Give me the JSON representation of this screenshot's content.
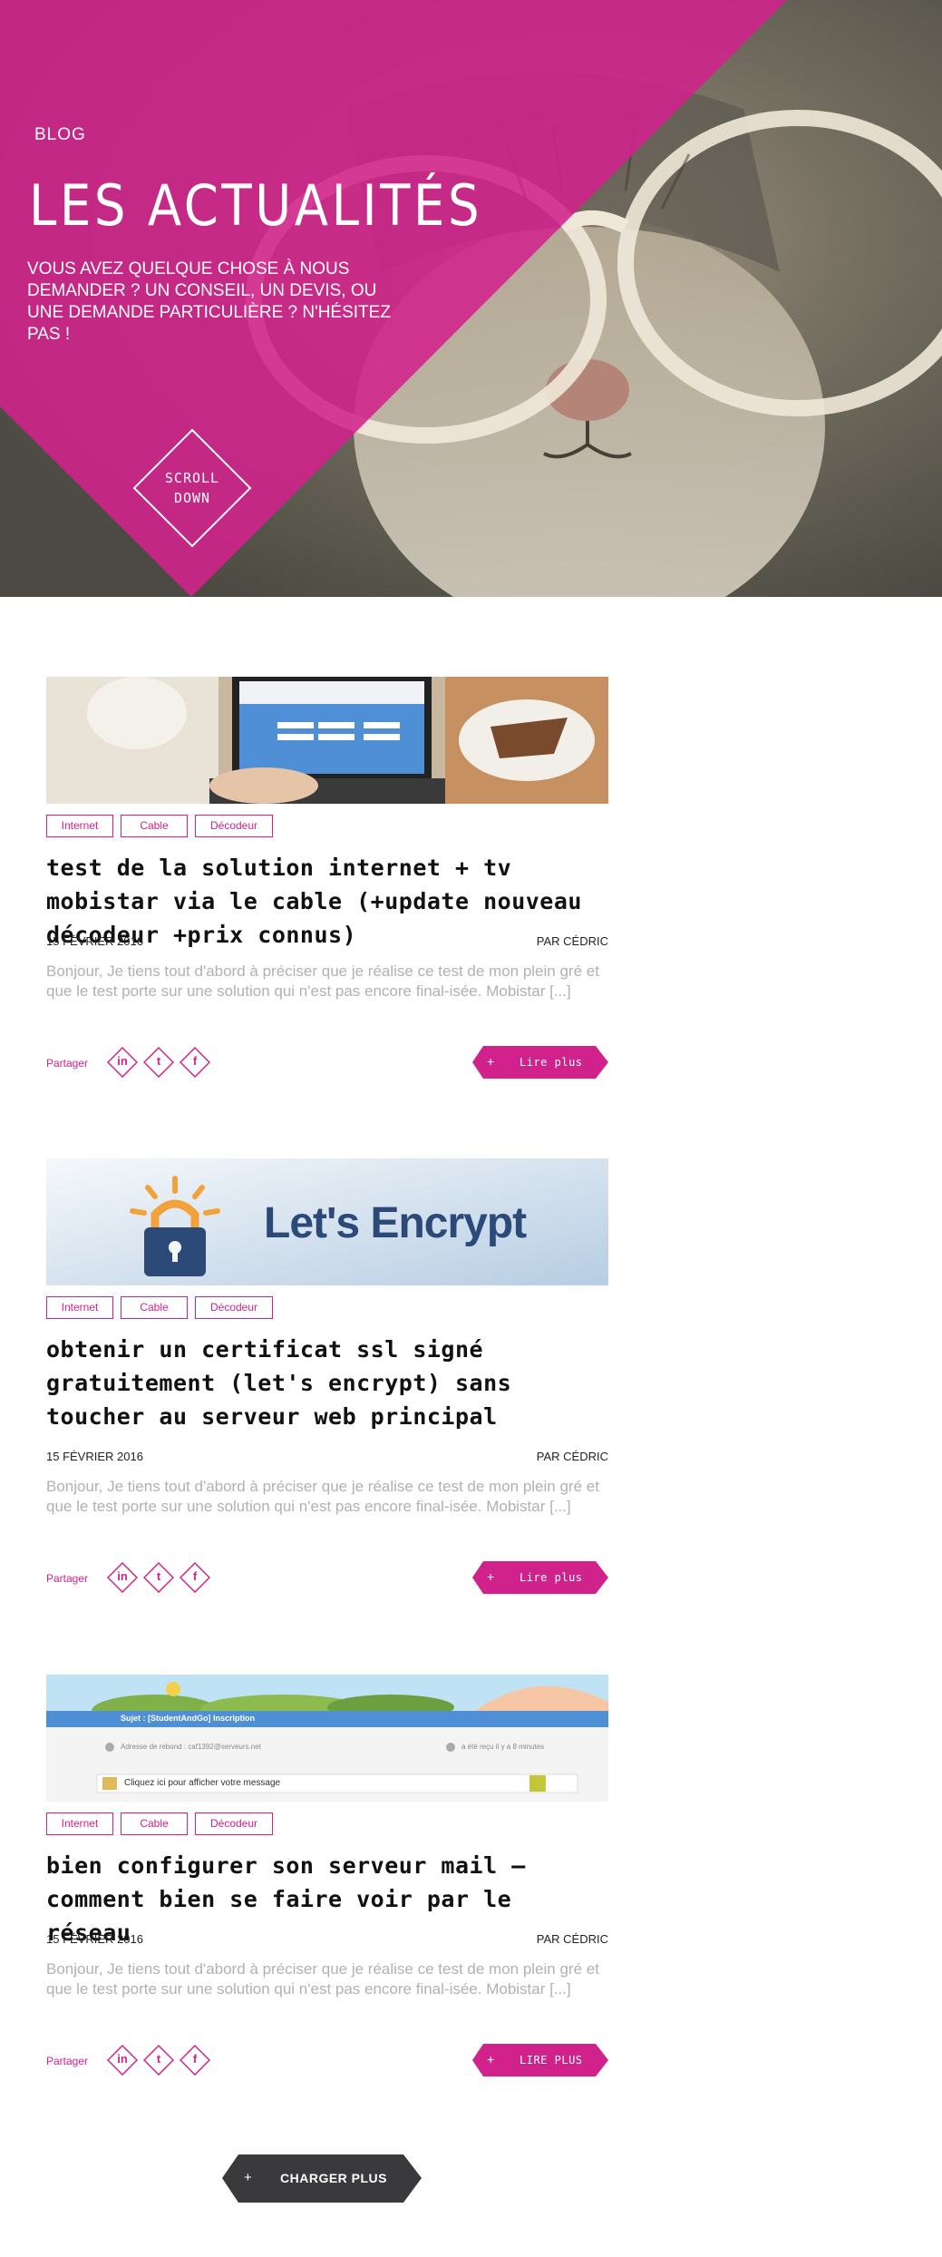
{
  "hero": {
    "breadcrumb": "BLOG",
    "title": "LES ACTUALITÉS",
    "subtitle": "VOUS AVEZ QUELQUE CHOSE À NOUS DEMANDER ? UN CONSEIL, UN DEVIS, OU UNE DEMANDE PARTICULIÈRE ? N'HÉSITEZ PAS !",
    "scroll_line1": "SCROLL",
    "scroll_line2": "DOWN",
    "accent_color": "#d1228c"
  },
  "articles": [
    {
      "tags": [
        "Internet",
        "Cable",
        "Décodeur"
      ],
      "title": "Test de la solution Internet + TV Mobistar via le cable (+update nouveau décodeur +prix connus)",
      "date": "15 FÉVRIER 2016",
      "author": "PAR CÉDRIC",
      "excerpt": "Bonjour, Je tiens tout d'abord à préciser que je réalise ce test de mon plein gré et que le test porte sur une solution qui n'est pas encore final-isée. Mobistar [...]",
      "share_label": "Partager",
      "read_more": "Lire plus"
    },
    {
      "tags": [
        "Internet",
        "Cable",
        "Décodeur"
      ],
      "title": "Obtenir un certificat SSL signé gratuitement (Let's Encrypt) sans toucher au serveur web principal",
      "date": "15 FÉVRIER 2016",
      "author": "PAR CÉDRIC",
      "excerpt": "Bonjour, Je tiens tout d'abord à préciser que je réalise ce test de mon plein gré et que le test porte sur une solution qui n'est pas encore final-isée. Mobistar [...]",
      "share_label": "Partager",
      "read_more": "Lire plus",
      "image_text": "Let's Encrypt"
    },
    {
      "tags": [
        "Internet",
        "Cable",
        "Décodeur"
      ],
      "title": "Bien configurer son serveur mail – comment bien se faire voir par le réseau",
      "date": "15 FÉVRIER 2016",
      "author": "PAR CÉDRIC",
      "excerpt": "Bonjour, Je tiens tout d'abord à préciser que je réalise ce test de mon plein gré et que le test porte sur une solution qui n'est pas encore final-isée. Mobistar [...]",
      "share_label": "Partager",
      "read_more": "LIRE PLUS",
      "image_subject": "Sujet : [StudentAndGo] Inscription",
      "image_sender": "Adresse de rebond : caf1392@serveurs.net",
      "image_received": "a été reçu il y a 8 minutes",
      "image_cta": "Cliquez ici pour afficher votre message"
    }
  ],
  "share_icons": [
    "linkedin-icon",
    "twitter-icon",
    "facebook-icon"
  ],
  "share_glyphs": {
    "linkedin": "in",
    "twitter": "t",
    "facebook": "f"
  },
  "load_more": {
    "plus": "+",
    "label": "CHARGER PLUS"
  },
  "read_plus": "+",
  "tag_colors": {
    "accent": "#d1228c",
    "dark": "#333333"
  }
}
